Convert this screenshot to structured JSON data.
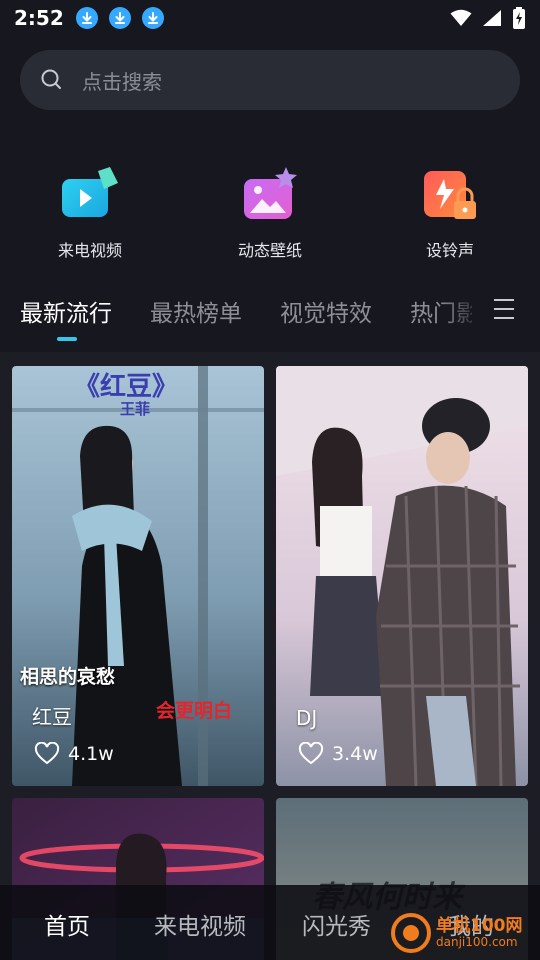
{
  "status_bar": {
    "time": "2:52"
  },
  "search": {
    "placeholder": "点击搜索"
  },
  "quick_actions": [
    {
      "label": "来电视频",
      "icon": "video-play-icon"
    },
    {
      "label": "动态壁纸",
      "icon": "wallpaper-icon"
    },
    {
      "label": "设铃声",
      "icon": "ringtone-lock-icon"
    }
  ],
  "tabs": [
    "最新流行",
    "最热榜单",
    "视觉特效",
    "热门影"
  ],
  "colors": {
    "accent": "#35c6e8",
    "background": "#16171f",
    "search_bg": "#2a2c35"
  },
  "cards": [
    {
      "overlay_top": "《红豆》",
      "overlay_sub": "王菲",
      "overlay_mid": "相思的哀愁",
      "overlay_red": "会更明白",
      "title": "红豆",
      "likes": "4.1w"
    },
    {
      "title": "DJ",
      "likes": "3.4w"
    },
    {
      "title": "",
      "likes": ""
    },
    {
      "overlay_top": "春风何时来",
      "title": "",
      "likes": ""
    }
  ],
  "bottom_nav": [
    "首页",
    "来电视频",
    "闪光秀",
    "我的"
  ],
  "watermark": {
    "site": "单机100网",
    "url": "danji100.com"
  }
}
